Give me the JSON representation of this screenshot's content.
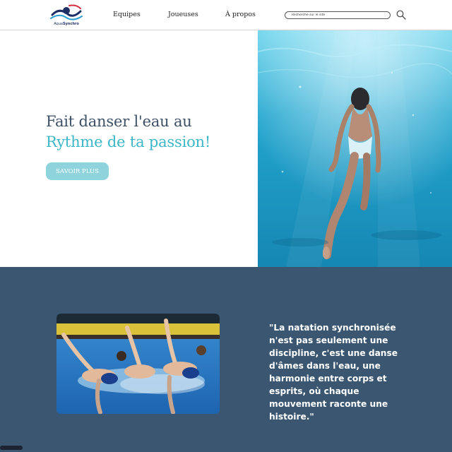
{
  "brand": {
    "prefix": "Aqua",
    "suffix": "Synchro"
  },
  "nav": {
    "items": [
      {
        "label": "Equipes"
      },
      {
        "label": "Joueuses"
      },
      {
        "label": "À propos"
      }
    ]
  },
  "search": {
    "placeholder": "Recherche sur le site"
  },
  "hero": {
    "line1": "Fait danser l'eau au",
    "line2": "Rythme de ta passion!",
    "cta_label": "SAVOIR PLUS"
  },
  "quote": {
    "text": "\"La natation synchronisée n'est pas seulement une discipline, c'est une danse d'âmes dans l'eau, une harmonie entre corps et esprits, où chaque mouvement raconte une histoire.\""
  },
  "colors": {
    "title_dark": "#3d5066",
    "title_accent": "#3bb7c8",
    "button": "#8fd4dd",
    "section_bg": "#3b5670"
  }
}
